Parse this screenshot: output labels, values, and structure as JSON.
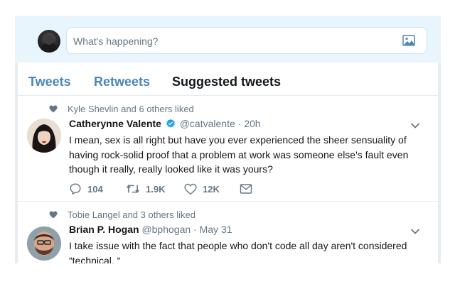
{
  "compose": {
    "placeholder": "What's happening?"
  },
  "tabs": [
    {
      "label": "Tweets",
      "active": false
    },
    {
      "label": "Retweets",
      "active": false
    },
    {
      "label": "Suggested tweets",
      "active": true
    }
  ],
  "tweets": [
    {
      "context": "Kyle Shevlin and 6 others liked",
      "name": "Catherynne Valente",
      "verified": true,
      "handle": "@catvalente",
      "separator": "·",
      "time": "20h",
      "text": "I mean, sex is all right but have you ever experienced the sheer sensuality of having rock-solid proof that a problem at work was someone else's fault even though it really, really looked like it was yours?",
      "replies": "104",
      "retweets": "1.9K",
      "likes": "12K"
    },
    {
      "context": "Tobie Langel and 3 others liked",
      "name": "Brian P. Hogan",
      "verified": false,
      "handle": "@bphogan",
      "separator": "·",
      "time": "May 31",
      "text": "I take issue with the fact that people who don't code all day aren't considered “technical. “"
    }
  ],
  "colors": {
    "accent": "#4a87b8",
    "verified": "#1da1f2",
    "muted": "#657786",
    "text": "#14171a"
  }
}
